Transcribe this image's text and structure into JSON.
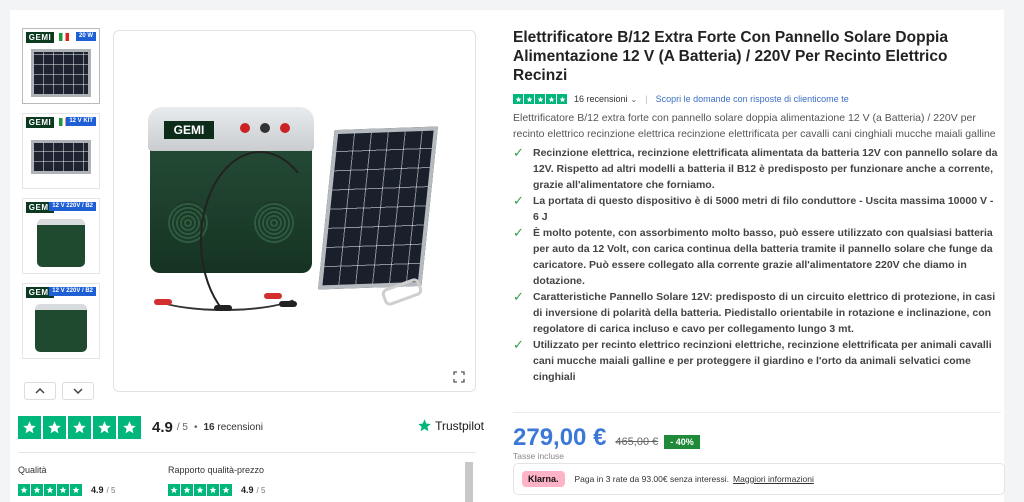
{
  "thumbnails": [
    {
      "brand": "GEMI",
      "tag": "20 W",
      "kind": "panel"
    },
    {
      "brand": "GEMI",
      "tag": "12 V KIT",
      "kind": "panel"
    },
    {
      "brand": "GEMI",
      "tag": "12 V 220V / B2",
      "kind": "box"
    },
    {
      "brand": "GEMI",
      "tag": "12 V 220V / B2",
      "kind": "box"
    }
  ],
  "gallery_nav": {
    "up_icon": "chevron-up-icon",
    "down_icon": "chevron-down-icon"
  },
  "main_image": {
    "brand": "GEMI",
    "expand_icon": "expand-icon"
  },
  "rating": {
    "score": "4.9",
    "out_of": "/ 5",
    "separator": "•",
    "review_count": "16",
    "review_label": "recensioni",
    "provider": "Trustpilot",
    "sub_ratings": [
      {
        "label": "Qualità",
        "score": "4.9",
        "out_of": "/ 5"
      },
      {
        "label": "Rapporto qualità-prezzo",
        "score": "4.9",
        "out_of": "/ 5"
      }
    ]
  },
  "product": {
    "title": "Elettrificatore B/12 Extra Forte Con Pannello Solare Doppia Alimentazione 12 V (A Batteria) / 220V Per Recinto Elettrico Recinzi",
    "reviews_label": "16 recensioni",
    "qa_link": "Scopri le domande con risposte di clienticome te",
    "description": "Elettrificatore B/12 extra forte con pannello solare doppia alimentazione 12 V (a Batteria) / 220V per recinto elettrico recinzione elettrica recinzione elettrificata per cavalli cani cinghiali mucche maiali galline",
    "bullets": [
      "Recinzione elettrica, recinzione elettrificata alimentata da batteria 12V con pannello solare da 12V. Rispetto ad altri modelli a batteria il B12 è predisposto per funzionare anche a corrente, grazie all'alimentatore che forniamo.",
      "La portata di questo dispositivo è di 5000 metri di filo conduttore - Uscita massima 10000 V - 6 J",
      "È molto potente, con assorbimento molto basso, può essere utilizzato con qualsiasi batteria per auto da 12 Volt, con carica continua della batteria tramite il pannello solare che funge da caricatore. Può essere collegato alla corrente grazie all'alimentatore 220V che diamo in dotazione.",
      "Caratteristiche Pannello Solare 12V: predisposto di un circuito elettrico di protezione, in casi di inversione di polarità della batteria. Piedistallo orientabile in rotazione e inclinazione, con regolatore di carica incluso e cavo per collegamento lungo 3 mt.",
      "Utilizzato per recinto elettrico recinzioni elettriche, recinzione elettrificata per animali cavalli cani mucche maiali galline e per proteggere il giardino e l'orto da animali selvatici come cinghiali"
    ],
    "price": "279,00 €",
    "old_price": "465,00 €",
    "discount": "- 40%",
    "tax_note": "Tasse incluse"
  },
  "klarna": {
    "badge": "Klarna.",
    "text": "Paga in 3 rate da 93.00€ senza interessi.",
    "link": "Maggiori informazioni"
  },
  "colors": {
    "trustpilot_green": "#00b67a",
    "price_blue": "#3b78d8",
    "discount_green": "#1f8a3a",
    "klarna_pink": "#ffb3c7"
  }
}
